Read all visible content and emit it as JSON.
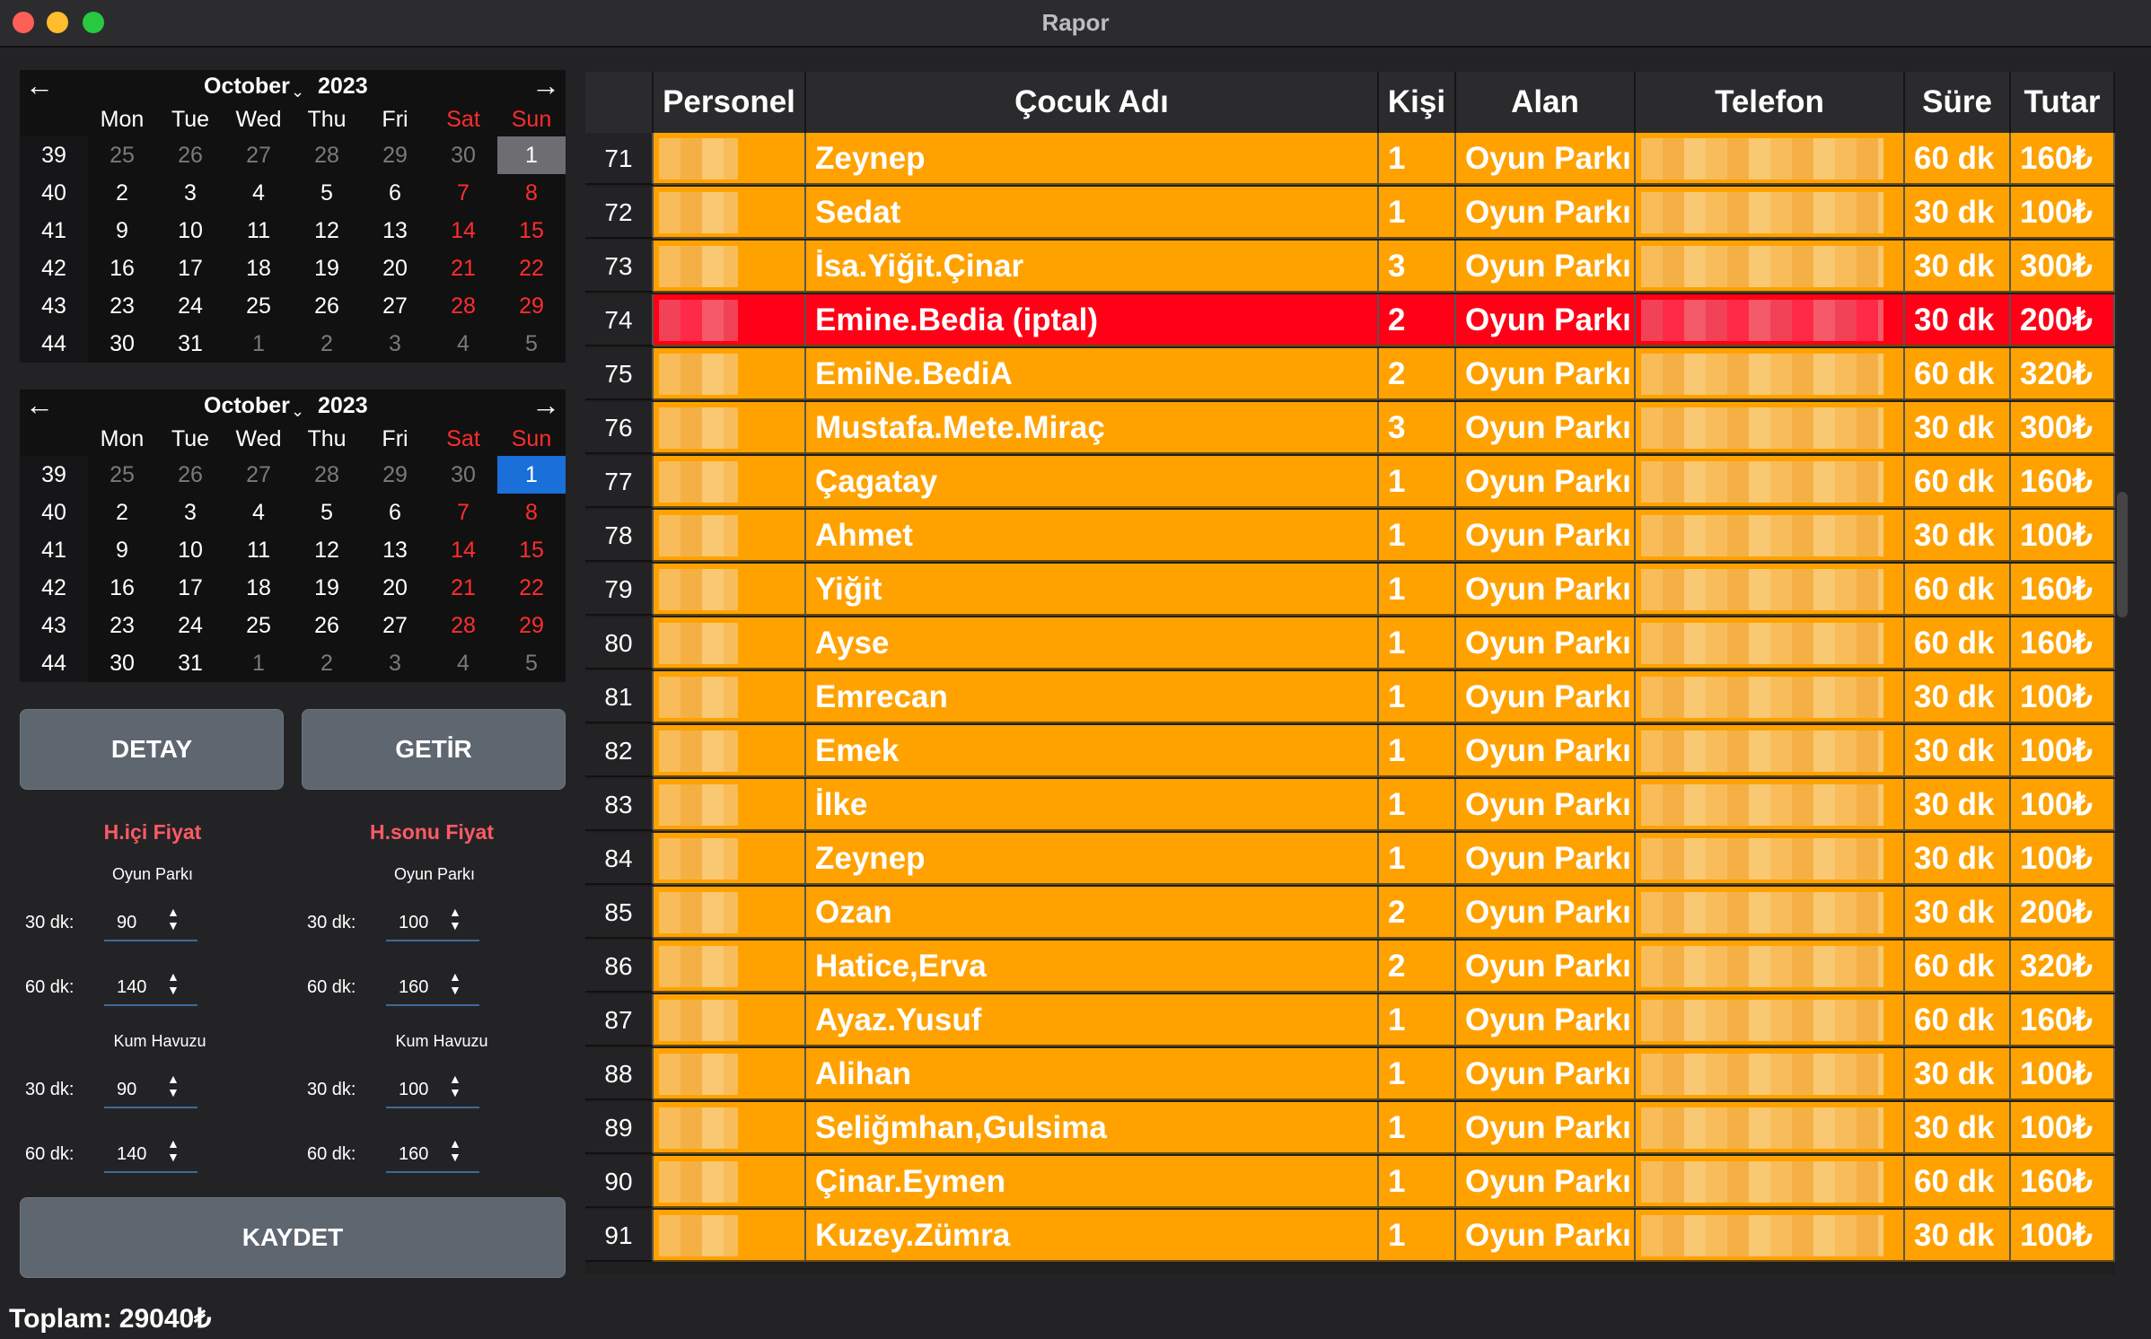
{
  "window": {
    "title": "Rapor"
  },
  "calendar1": {
    "month": "October",
    "year": "2023",
    "dow": [
      "Mon",
      "Tue",
      "Wed",
      "Thu",
      "Fri",
      "Sat",
      "Sun"
    ],
    "weeks": [
      {
        "wk": "39",
        "days": [
          "25",
          "26",
          "27",
          "28",
          "29",
          "30",
          "1"
        ]
      },
      {
        "wk": "40",
        "days": [
          "2",
          "3",
          "4",
          "5",
          "6",
          "7",
          "8"
        ]
      },
      {
        "wk": "41",
        "days": [
          "9",
          "10",
          "11",
          "12",
          "13",
          "14",
          "15"
        ]
      },
      {
        "wk": "42",
        "days": [
          "16",
          "17",
          "18",
          "19",
          "20",
          "21",
          "22"
        ]
      },
      {
        "wk": "43",
        "days": [
          "23",
          "24",
          "25",
          "26",
          "27",
          "28",
          "29"
        ]
      },
      {
        "wk": "44",
        "days": [
          "30",
          "31",
          "1",
          "2",
          "3",
          "4",
          "5"
        ]
      }
    ]
  },
  "calendar2": {
    "month": "October",
    "year": "2023",
    "dow": [
      "Mon",
      "Tue",
      "Wed",
      "Thu",
      "Fri",
      "Sat",
      "Sun"
    ],
    "weeks": [
      {
        "wk": "39",
        "days": [
          "25",
          "26",
          "27",
          "28",
          "29",
          "30",
          "1"
        ]
      },
      {
        "wk": "40",
        "days": [
          "2",
          "3",
          "4",
          "5",
          "6",
          "7",
          "8"
        ]
      },
      {
        "wk": "41",
        "days": [
          "9",
          "10",
          "11",
          "12",
          "13",
          "14",
          "15"
        ]
      },
      {
        "wk": "42",
        "days": [
          "16",
          "17",
          "18",
          "19",
          "20",
          "21",
          "22"
        ]
      },
      {
        "wk": "43",
        "days": [
          "23",
          "24",
          "25",
          "26",
          "27",
          "28",
          "29"
        ]
      },
      {
        "wk": "44",
        "days": [
          "30",
          "31",
          "1",
          "2",
          "3",
          "4",
          "5"
        ]
      }
    ]
  },
  "buttons": {
    "detay": "DETAY",
    "getir": "GETİR",
    "kaydet": "KAYDET"
  },
  "prices": {
    "weekday_title": "H.içi Fiyat",
    "weekend_title": "H.sonu Fiyat",
    "oyun_parki": "Oyun Parkı",
    "kum_havuzu": "Kum Havuzu",
    "label_30": "30 dk:",
    "label_60": "60 dk:",
    "weekday": {
      "op30": "90",
      "op60": "140",
      "kh30": "90",
      "kh60": "140"
    },
    "weekend": {
      "op30": "100",
      "op60": "160",
      "kh30": "100",
      "kh60": "160"
    }
  },
  "total": "Toplam: 29040₺",
  "table": {
    "headers": [
      "Personel",
      "Çocuk Adı",
      "Kişi",
      "Alan",
      "Telefon",
      "Süre",
      "Tutar"
    ],
    "rows": [
      {
        "no": "71",
        "name": "Zeynep",
        "kisi": "1",
        "alan": "Oyun Parkı",
        "sure": "60 dk",
        "tutar": "160₺"
      },
      {
        "no": "72",
        "name": "Sedat",
        "kisi": "1",
        "alan": "Oyun Parkı",
        "sure": "30 dk",
        "tutar": "100₺"
      },
      {
        "no": "73",
        "name": "İsa.Yiğit.Çinar",
        "kisi": "3",
        "alan": "Oyun Parkı",
        "sure": "30 dk",
        "tutar": "300₺"
      },
      {
        "no": "74",
        "name": "Emine.Bedia (iptal)",
        "kisi": "2",
        "alan": "Oyun Parkı",
        "sure": "30 dk",
        "tutar": "200₺",
        "cancelled": true
      },
      {
        "no": "75",
        "name": "EmiNe.BediA",
        "kisi": "2",
        "alan": "Oyun Parkı",
        "sure": "60 dk",
        "tutar": "320₺"
      },
      {
        "no": "76",
        "name": "Mustafa.Mete.Miraç",
        "kisi": "3",
        "alan": "Oyun Parkı",
        "sure": "30 dk",
        "tutar": "300₺"
      },
      {
        "no": "77",
        "name": "Çagatay",
        "kisi": "1",
        "alan": "Oyun Parkı",
        "sure": "60 dk",
        "tutar": "160₺"
      },
      {
        "no": "78",
        "name": "Ahmet",
        "kisi": "1",
        "alan": "Oyun Parkı",
        "sure": "30 dk",
        "tutar": "100₺"
      },
      {
        "no": "79",
        "name": "Yiğit",
        "kisi": "1",
        "alan": "Oyun Parkı",
        "sure": "60 dk",
        "tutar": "160₺"
      },
      {
        "no": "80",
        "name": "Ayse",
        "kisi": "1",
        "alan": "Oyun Parkı",
        "sure": "60 dk",
        "tutar": "160₺"
      },
      {
        "no": "81",
        "name": "Emrecan",
        "kisi": "1",
        "alan": "Oyun Parkı",
        "sure": "30 dk",
        "tutar": "100₺"
      },
      {
        "no": "82",
        "name": "Emek",
        "kisi": "1",
        "alan": "Oyun Parkı",
        "sure": "30 dk",
        "tutar": "100₺"
      },
      {
        "no": "83",
        "name": "İlke",
        "kisi": "1",
        "alan": "Oyun Parkı",
        "sure": "30 dk",
        "tutar": "100₺"
      },
      {
        "no": "84",
        "name": "Zeynep",
        "kisi": "1",
        "alan": "Oyun Parkı",
        "sure": "30 dk",
        "tutar": "100₺"
      },
      {
        "no": "85",
        "name": "Ozan",
        "kisi": "2",
        "alan": "Oyun Parkı",
        "sure": "30 dk",
        "tutar": "200₺"
      },
      {
        "no": "86",
        "name": "Hatice,Erva",
        "kisi": "2",
        "alan": "Oyun Parkı",
        "sure": "60 dk",
        "tutar": "320₺"
      },
      {
        "no": "87",
        "name": "Ayaz.Yusuf",
        "kisi": "1",
        "alan": "Oyun Parkı",
        "sure": "60 dk",
        "tutar": "160₺"
      },
      {
        "no": "88",
        "name": "Alihan",
        "kisi": "1",
        "alan": "Oyun Parkı",
        "sure": "30 dk",
        "tutar": "100₺"
      },
      {
        "no": "89",
        "name": "Seliğmhan,Gulsima",
        "kisi": "1",
        "alan": "Oyun Parkı",
        "sure": "30 dk",
        "tutar": "100₺"
      },
      {
        "no": "90",
        "name": "Çinar.Eymen",
        "kisi": "1",
        "alan": "Oyun Parkı",
        "sure": "60 dk",
        "tutar": "160₺"
      },
      {
        "no": "91",
        "name": "Kuzey.Zümra",
        "kisi": "1",
        "alan": "Oyun Parkı",
        "sure": "30 dk",
        "tutar": "100₺"
      }
    ]
  }
}
